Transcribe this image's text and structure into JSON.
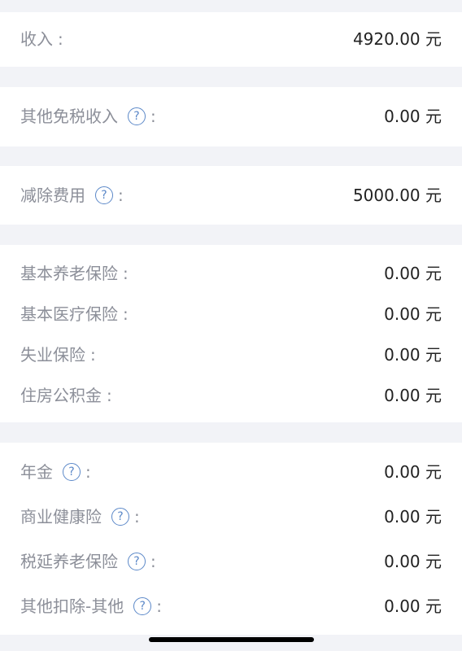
{
  "sections": [
    {
      "rows": [
        {
          "label": "收入",
          "help": false,
          "colon": ":",
          "value": "4920.00 元"
        }
      ]
    },
    {
      "rows": [
        {
          "label": "其他免税收入",
          "help": true,
          "colon": ":",
          "value": "0.00 元"
        }
      ]
    },
    {
      "rows": [
        {
          "label": "减除费用",
          "help": true,
          "colon": ":",
          "value": "5000.00 元"
        }
      ]
    },
    {
      "rows": [
        {
          "label": "基本养老保险",
          "help": false,
          "colon": ":",
          "value": "0.00 元"
        },
        {
          "label": "基本医疗保险",
          "help": false,
          "colon": ":",
          "value": "0.00 元"
        },
        {
          "label": "失业保险",
          "help": false,
          "colon": ":",
          "value": "0.00 元"
        },
        {
          "label": "住房公积金",
          "help": false,
          "colon": ":",
          "value": "0.00 元"
        }
      ]
    },
    {
      "rows": [
        {
          "label": "年金",
          "help": true,
          "colon": ":",
          "value": "0.00 元"
        },
        {
          "label": "商业健康险",
          "help": true,
          "colon": ":",
          "value": "0.00 元"
        },
        {
          "label": "税延养老保险",
          "help": true,
          "colon": ":",
          "value": "0.00 元"
        },
        {
          "label": "其他扣除-其他",
          "help": true,
          "colon": ":",
          "value": "0.00 元"
        }
      ]
    }
  ],
  "help_icon_glyph": "?",
  "colors": {
    "background": "#f2f3f7",
    "card": "#ffffff",
    "label": "#8c8f99",
    "value": "#222222",
    "help_icon": "#5b88c8"
  }
}
